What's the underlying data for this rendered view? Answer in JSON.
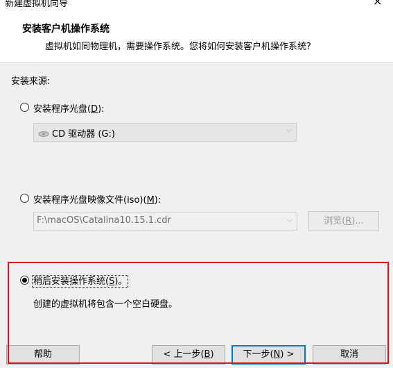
{
  "window": {
    "title": "新建虚拟机向导",
    "close_glyph": "×"
  },
  "header": {
    "title": "安装客户机操作系统",
    "subtitle": "虚拟机如同物理机，需要操作系统。您将如何安装客户机操作系统?"
  },
  "install_source": {
    "label": "安装来源:",
    "disc": {
      "label_prefix": "安装程序光盘(",
      "mnemonic": "D",
      "label_suffix": "):",
      "selected": false,
      "drive_value": "CD 驱动器 (G:)",
      "drive_icon": "cd-drive-icon"
    },
    "iso": {
      "label_prefix": "安装程序光盘映像文件(iso)(",
      "mnemonic": "M",
      "label_suffix": "):",
      "selected": false,
      "path_value": "F:\\macOS\\Catalina10.15.1.cdr",
      "browse_prefix": "浏览(",
      "browse_mnemonic": "R",
      "browse_suffix": ")..."
    },
    "later": {
      "label_prefix": "稍后安装操作系统(",
      "mnemonic": "S",
      "label_suffix": ")。",
      "selected": true,
      "description": "创建的虚拟机将包含一个空白硬盘。"
    }
  },
  "footer": {
    "help": "帮助",
    "back_prefix": "< 上一步(",
    "back_mnemonic": "B",
    "back_suffix": ")",
    "next_prefix": "下一步(",
    "next_mnemonic": "N",
    "next_suffix": ") >",
    "cancel": "取消"
  },
  "colors": {
    "highlight_border": "#e01010",
    "default_button_border": "#0078d7"
  }
}
